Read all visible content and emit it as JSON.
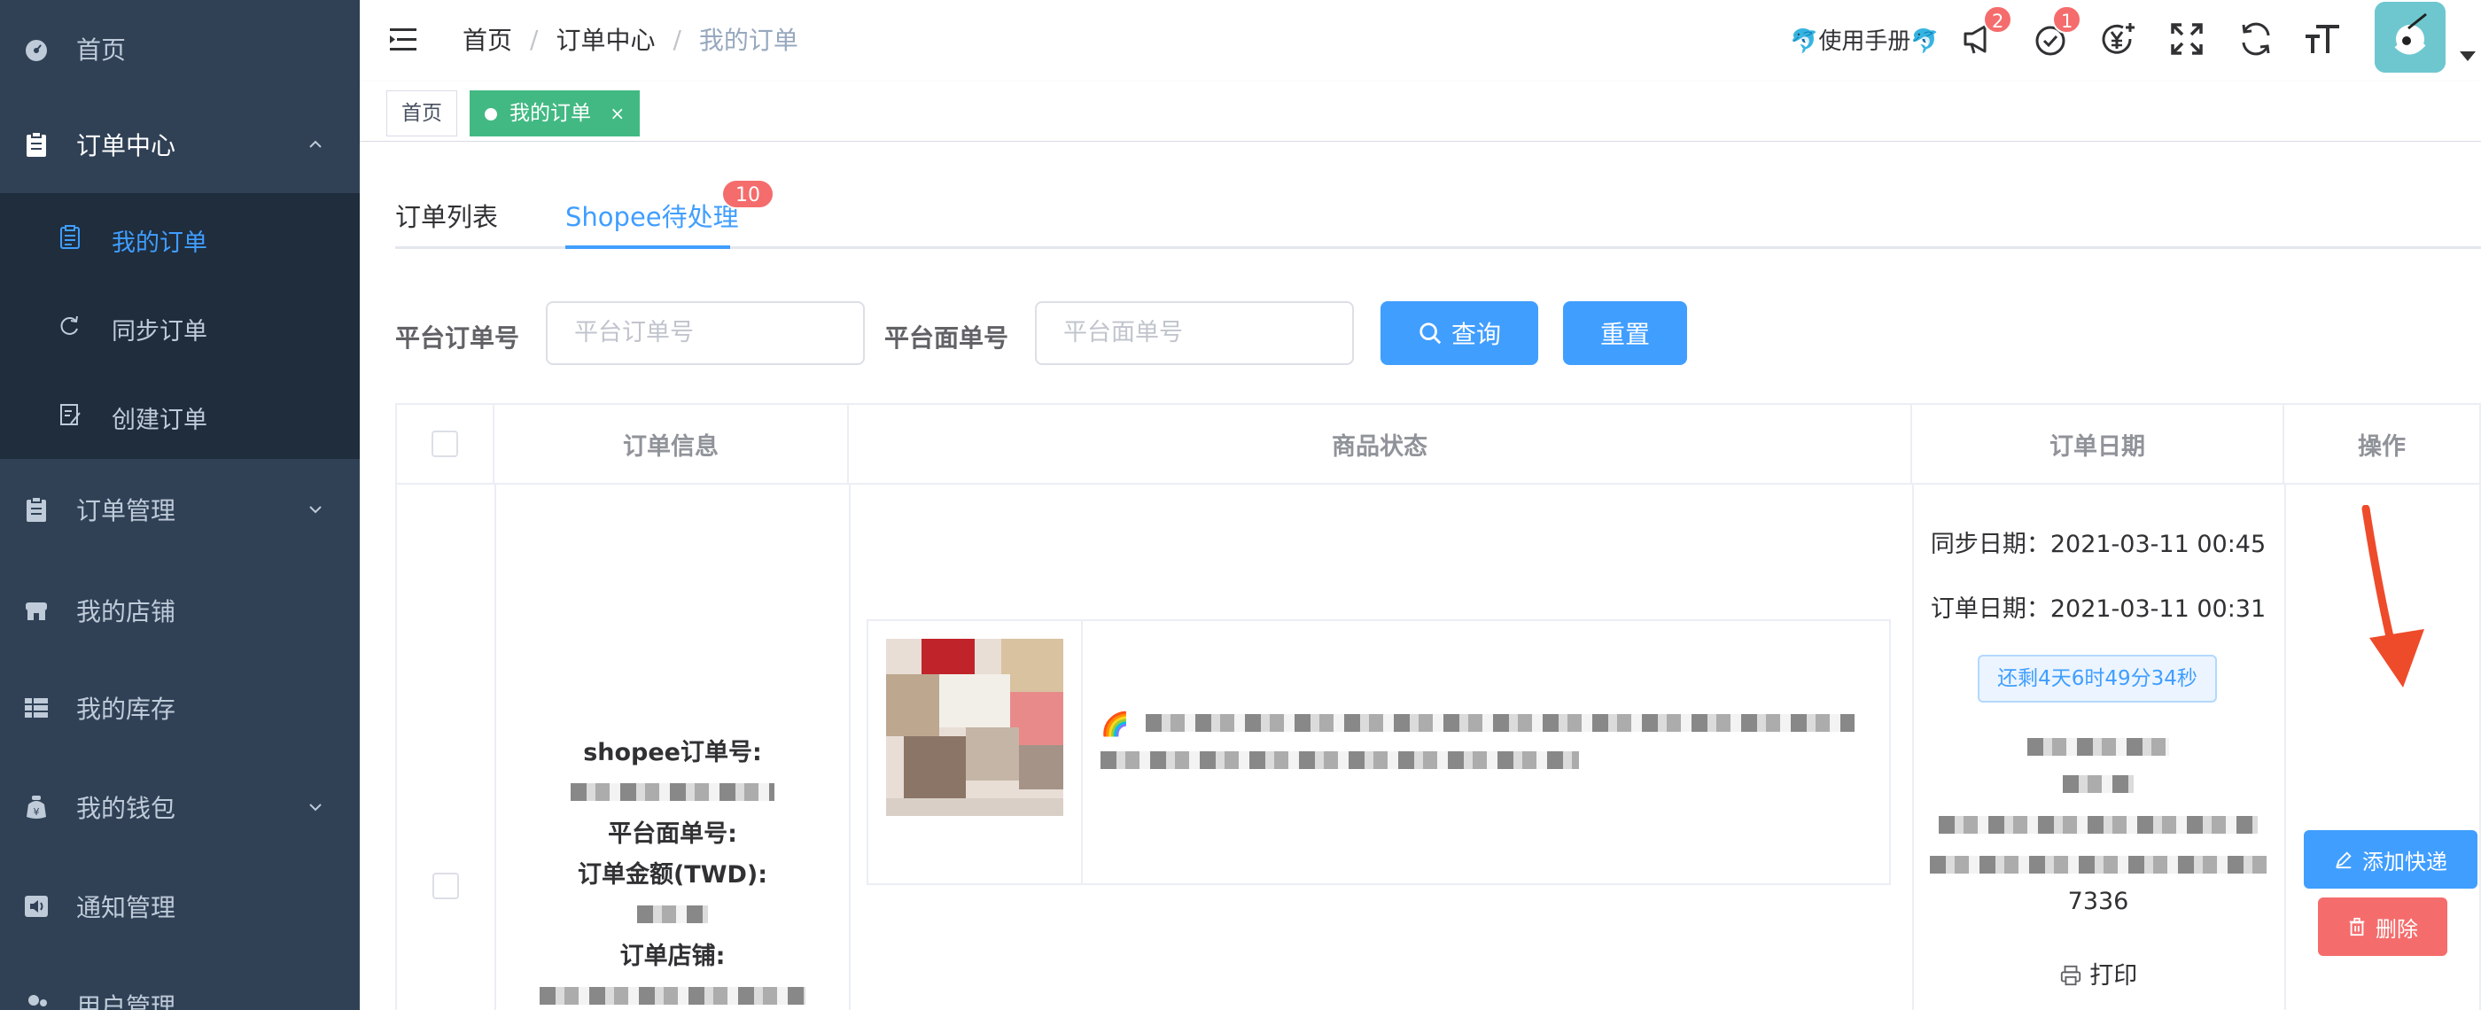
{
  "sidebar": {
    "items": [
      {
        "label": "首页",
        "icon": "dashboard-icon"
      },
      {
        "label": "订单中心",
        "icon": "clipboard-icon"
      },
      {
        "label": "订单管理",
        "icon": "clipboard-icon"
      },
      {
        "label": "我的店铺",
        "icon": "shop-icon"
      },
      {
        "label": "我的库存",
        "icon": "grid-icon"
      },
      {
        "label": "我的钱包",
        "icon": "wallet-icon"
      },
      {
        "label": "通知管理",
        "icon": "speaker-icon"
      },
      {
        "label": "用户管理",
        "icon": "user-icon"
      }
    ],
    "sub_items": [
      {
        "label": "我的订单",
        "icon": "document-icon"
      },
      {
        "label": "同步订单",
        "icon": "refresh-icon"
      },
      {
        "label": "创建订单",
        "icon": "edit-document-icon"
      }
    ]
  },
  "header": {
    "breadcrumb": [
      "首页",
      "订单中心",
      "我的订单"
    ],
    "breadcrumb_sep": "/",
    "manual": "🐬使用手册🐬",
    "badge_notice": "2",
    "badge_todo": "1"
  },
  "tags": {
    "home": "首页",
    "current": "我的订单",
    "close": "×"
  },
  "tabs": {
    "list": "订单列表",
    "pending": "Shopee待处理",
    "pending_badge": "10"
  },
  "search": {
    "platform_order_label": "平台订单号",
    "platform_order_placeholder": "平台订单号",
    "platform_sheet_label": "平台面单号",
    "platform_sheet_placeholder": "平台面单号",
    "query": "查询",
    "reset": "重置"
  },
  "table": {
    "headers": [
      "订单信息",
      "商品状态",
      "订单日期",
      "操作"
    ],
    "row": {
      "shopee_order_label": "shopee订单号:",
      "sheet_label": "平台面单号:",
      "amount_label": "订单金额(TWD):",
      "shop_label": "订单店铺:",
      "sync_date": "同步日期：2021-03-11 00:45",
      "order_date": "订单日期：2021-03-11 00:31",
      "countdown": "还剩4天6时49分34秒",
      "postcode_tail": "7336",
      "print": "打印",
      "add_express": "添加快递",
      "delete": "删除"
    }
  },
  "colors": {
    "sidebar_bg": "#304156",
    "primary": "#409eff",
    "danger": "#f56c6c",
    "tag_active": "#42b983"
  }
}
